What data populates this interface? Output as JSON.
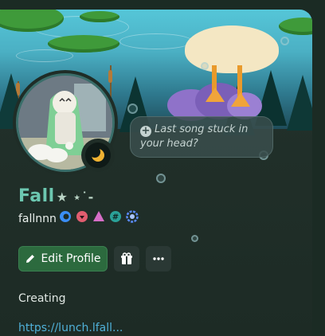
{
  "profile": {
    "display_name": "Fall",
    "name_decoration": "★ ⋆˙-",
    "username": "fallnnn",
    "custom_status": "Last song stuck in your head?",
    "about": "Creating",
    "link_partial": "https://lunch.lfall..."
  },
  "actions": {
    "edit_profile_label": "Edit Profile",
    "edit_icon": "pencil-icon",
    "nitro_icon": "gift-icon",
    "more_icon": "ellipsis-icon"
  },
  "status_indicator": "idle-moon-icon",
  "badges": [
    {
      "name": "nitro-badge-icon",
      "color": "#3a8ef5"
    },
    {
      "name": "heart-badge-icon",
      "color": "#e05d6f"
    },
    {
      "name": "triangle-badge-icon",
      "color": "#d66ec7"
    },
    {
      "name": "hashtag-badge-icon",
      "color": "#2aa198"
    },
    {
      "name": "quest-badge-icon",
      "color": "#5b8cff"
    }
  ],
  "colors": {
    "accent_name": "#6cc7b0",
    "primary_button": "#2c6a3e",
    "card_bg": "#1d2b25"
  }
}
